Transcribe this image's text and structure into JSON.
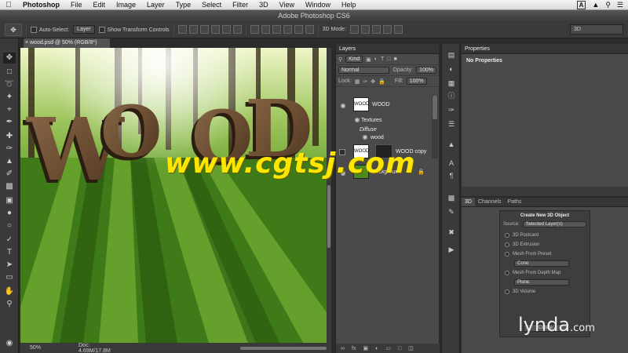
{
  "menubar": {
    "app": "Photoshop",
    "items": [
      "File",
      "Edit",
      "Image",
      "Layer",
      "Type",
      "Select",
      "Filter",
      "3D",
      "View",
      "Window",
      "Help"
    ],
    "right_badge": "A"
  },
  "window": {
    "title": "Adobe Photoshop CS6"
  },
  "options": {
    "auto_select_label": "Auto-Select:",
    "auto_select_value": "Layer",
    "show_transform_label": "Show Transform Controls",
    "mode_3d_label": "3D Mode:",
    "workspace": "3D"
  },
  "document": {
    "tab_title": "wood.psd @ 50% (RGB/8*)",
    "zoom": "50%",
    "doc_size": "Doc: 4.69M/17.8M"
  },
  "layers_panel": {
    "tab": "Layers",
    "filter_kind": "Kind",
    "blend_mode": "Normal",
    "opacity_label": "Opacity:",
    "opacity_value": "100%",
    "lock_label": "Lock:",
    "fill_label": "Fill:",
    "fill_value": "100%",
    "layers": [
      {
        "name": "WOOD",
        "thumb": "WOOD"
      },
      {
        "name": "Textures"
      },
      {
        "name": "Diffuse"
      },
      {
        "name": "wood"
      },
      {
        "name": "WOOD copy",
        "thumb": "WOOD"
      },
      {
        "name": "Background"
      }
    ],
    "footer_icons": [
      "link-icon",
      "fx-icon",
      "mask-icon",
      "adjustment-icon",
      "folder-icon",
      "new-layer-icon",
      "trash-icon"
    ]
  },
  "properties_panel": {
    "tab": "Properties",
    "body": "No Properties"
  },
  "panel_3d": {
    "tabs": [
      "3D",
      "Channels",
      "Paths"
    ],
    "title": "Create New 3D Object",
    "source_label": "Source:",
    "source_value": "Selected Layer(s)",
    "options": [
      "3D Postcard",
      "3D Extrusion",
      "Mesh From Preset",
      "Mesh From Depth Map",
      "3D Volume"
    ],
    "preset_value": "Cone",
    "depth_map_value": "Plane",
    "create_label": "Create"
  },
  "canvas_text": {
    "wood_letters": [
      "W",
      "O",
      "O",
      "D"
    ],
    "watermark": "www.cgtsj.com"
  },
  "branding": {
    "logo": "lynda",
    "logo_suffix": ".com"
  },
  "colors": {
    "accent": "#ffe600",
    "canvas_grass": "#3e7a18",
    "panel_bg": "#4a4a4a"
  }
}
